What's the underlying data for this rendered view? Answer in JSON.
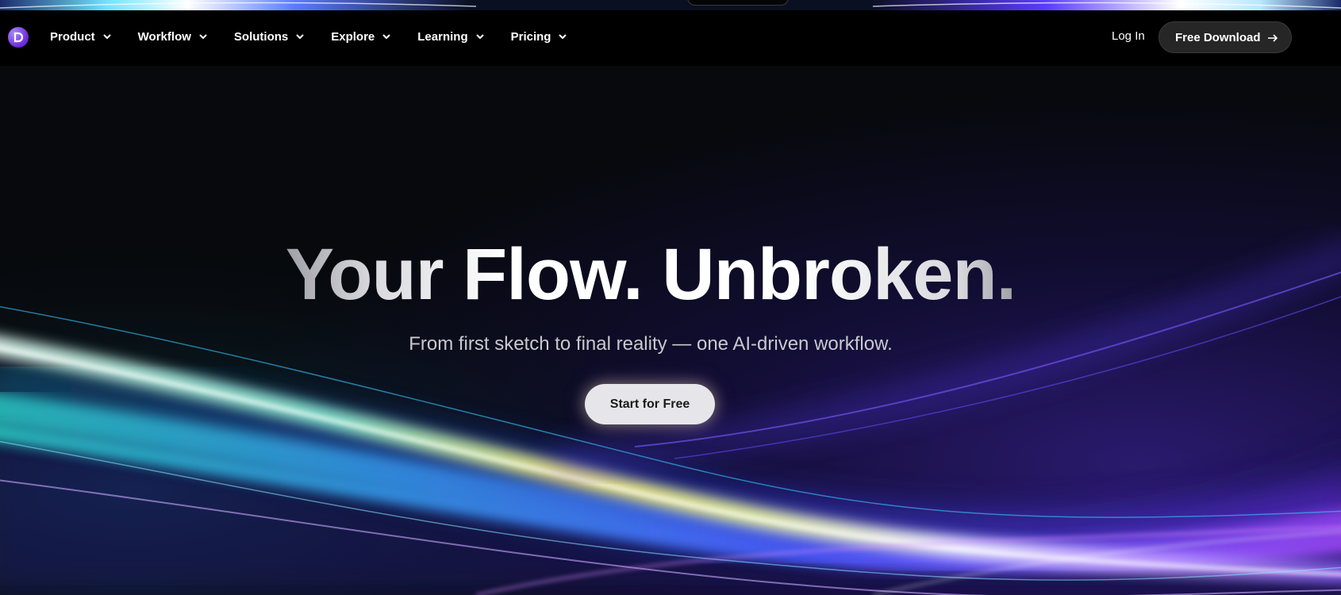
{
  "nav": {
    "items": [
      {
        "label": "Product"
      },
      {
        "label": "Workflow"
      },
      {
        "label": "Solutions"
      },
      {
        "label": "Explore"
      },
      {
        "label": "Learning"
      },
      {
        "label": "Pricing"
      }
    ],
    "login_label": "Log In",
    "download_label": "Free Download"
  },
  "hero": {
    "headline": "Your Flow. Unbroken.",
    "subheadline": "From first sketch to final reality — one AI-driven workflow.",
    "cta_label": "Start for Free"
  },
  "colors": {
    "background": "#07090c",
    "nav_background": "#000000",
    "cta_background": "#e6e6ea",
    "download_button_background": "#262626",
    "logo_accent": "#7c3aed"
  }
}
